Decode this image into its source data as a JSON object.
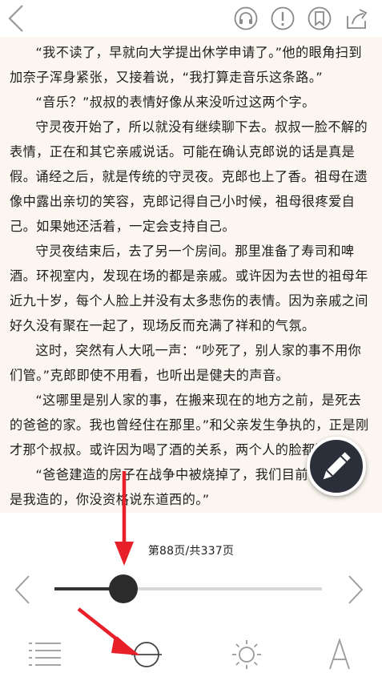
{
  "reader": {
    "paragraphs": [
      "“我不读了，早就向大学提出休学申请了。”他的眼角扫到加奈子浑身紧张，又接着说，“我打算走音乐这条路。”",
      "“音乐？”叔叔的表情好像从来没听过这两个字。",
      "守灵夜开始了，所以就没有继续聊下去。叔叔一脸不解的表情，正在和其它亲戚说话。可能在确认克郎说的话是真是假。",
      "诵经之后，就是传统的守灵夜。克郎也上了香。祖母在遗像中露出亲切的笑容，克郎记得自己小时候，祖母很疼爱自己。如果她还活着，一定会支持自己。",
      "守灵夜结束后，去了另一个房间。那里准备了寿司和啤酒。环视室内，发现在场的都是亲戚。或许因为去世的祖母年近九十岁，每个人脸上并没有太多悲伤的表情。因为亲戚之间好久没有聚在一起了，现场反而充满了祥和的气氛。",
      "这时，突然有人大吼一声：“吵死了，别人家的事不用你们管。”克郎即使不用看，也听出是健夫的声音。",
      "“这哪里是别人家的事，在搬来现在的地方之前，是死去的爸爸的家。我也曾经住在那里。”和父亲发生争执的，正是刚才那个叔叔。或许因为喝了酒的关系，两个人的脸都涨",
      "“爸爸建造的房子在战争中被烧掉了，我们目前住的房子是我造的，你没资格说东道西的。”"
    ]
  },
  "progress": {
    "page_label": "第88页/共337页",
    "current_page": 88,
    "total_pages": 337
  },
  "colors": {
    "reader_background": "#fbf7f0",
    "annotation_arrow": "#e8202a",
    "fab_background": "#2b2f3a",
    "slider_fill": "#333333",
    "slider_track": "#d9d9d9"
  },
  "icons": {
    "top_bar": [
      "back-arrow-icon",
      "headphones-icon",
      "report-icon",
      "bookmark-icon",
      "share-icon"
    ],
    "bottom_bar": [
      "table-of-contents-icon",
      "progress-icon",
      "brightness-icon",
      "font-icon"
    ],
    "fab": "pencil-icon"
  }
}
